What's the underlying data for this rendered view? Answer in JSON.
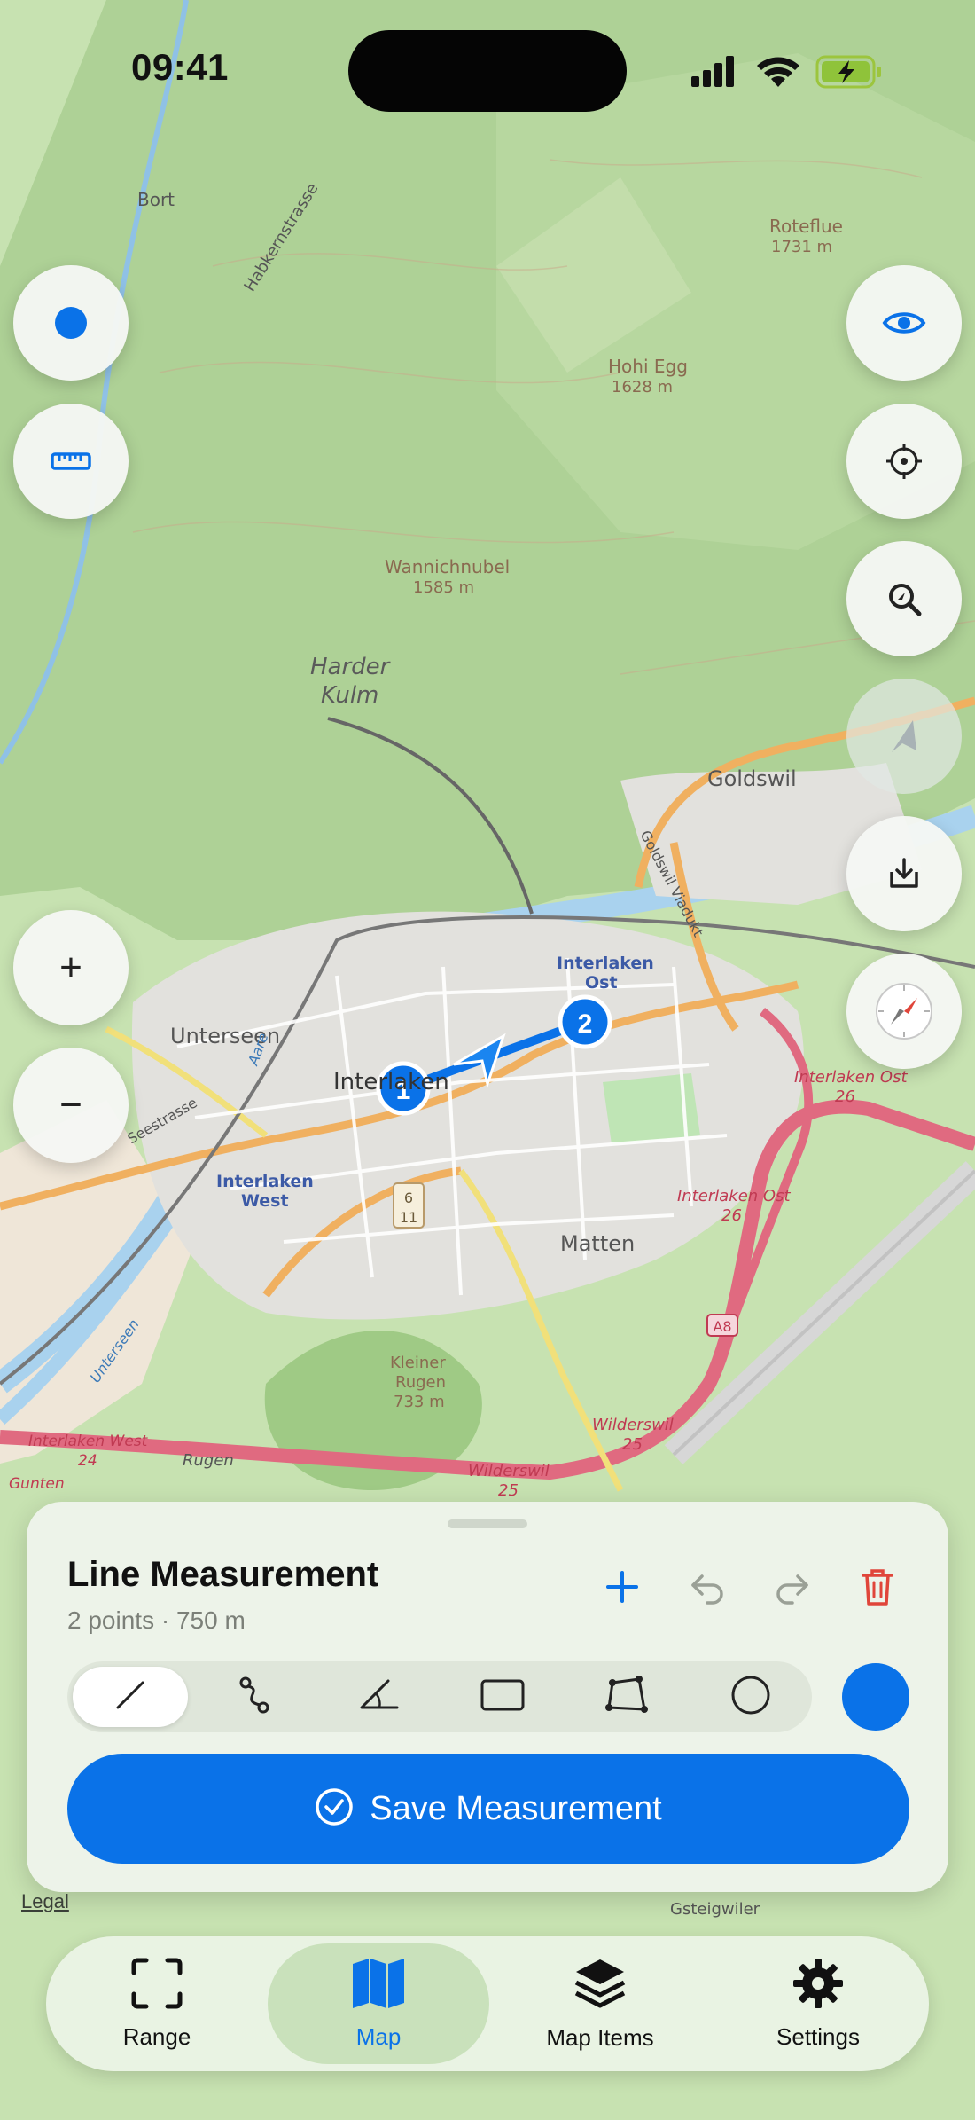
{
  "status_bar": {
    "time": "09:41"
  },
  "map": {
    "labels": [
      {
        "text": "Bort"
      },
      {
        "text": "Habkernstrasse"
      },
      {
        "text": "Roteflue"
      },
      {
        "text": "1731 m"
      },
      {
        "text": "Hohi Egg"
      },
      {
        "text": "1628 m"
      },
      {
        "text": "Wannichnubel"
      },
      {
        "text": "1585 m"
      },
      {
        "text": "Harder"
      },
      {
        "text": "Kulm"
      },
      {
        "text": "Goldswil"
      },
      {
        "text": "Interlaken"
      },
      {
        "text": "Ost"
      },
      {
        "text": "Unterseen"
      },
      {
        "text": "Interlaken"
      },
      {
        "text": "Interlaken"
      },
      {
        "text": "West"
      },
      {
        "text": "Seestrasse"
      },
      {
        "text": "Matten"
      },
      {
        "text": "Interlaken Ost"
      },
      {
        "text": "26"
      },
      {
        "text": "Interlaken Ost"
      },
      {
        "text": "26"
      },
      {
        "text": "Kleiner"
      },
      {
        "text": "Rugen"
      },
      {
        "text": "733 m"
      },
      {
        "text": "Interlaken West"
      },
      {
        "text": "24"
      },
      {
        "text": "Rugen"
      },
      {
        "text": "Wilderswil"
      },
      {
        "text": "25"
      },
      {
        "text": "Wilderswil"
      },
      {
        "text": "25"
      },
      {
        "text": "Gunten"
      },
      {
        "text": "Gsteigwiler"
      },
      {
        "text": "Goldswil Viadukt"
      },
      {
        "text": "A8"
      },
      {
        "text": "6"
      },
      {
        "text": "11"
      },
      {
        "text": "Aare"
      },
      {
        "text": "Unterseen"
      }
    ],
    "points": [
      "1",
      "2"
    ]
  },
  "controls": {
    "left": [
      "location-dot-icon",
      "ruler-icon"
    ],
    "zoom": {
      "in": "+",
      "out": "−"
    },
    "right": [
      "eye-icon",
      "crosshair-icon",
      "zoom-search-icon",
      "navigation-arrow-icon",
      "download-tray-icon",
      "compass-icon"
    ]
  },
  "sheet": {
    "title": "Line Measurement",
    "subtitle": "2 points · 750 m",
    "actions": [
      "add-point-icon",
      "undo-icon",
      "redo-icon",
      "trash-icon"
    ],
    "tools": [
      "line-tool",
      "path-tool",
      "angle-tool",
      "rectangle-tool",
      "polygon-tool",
      "circle-tool"
    ],
    "active_tool": "line-tool",
    "color": "#0a72e8",
    "save_label": "Save Measurement"
  },
  "legal": "Legal",
  "tabs": [
    {
      "label": "Range",
      "icon": "viewfinder-icon"
    },
    {
      "label": "Map",
      "icon": "map-icon",
      "active": true
    },
    {
      "label": "Map Items",
      "icon": "layers-icon"
    },
    {
      "label": "Settings",
      "icon": "gear-icon"
    }
  ],
  "colors": {
    "accent": "#0a72e8",
    "delete": "#e0453a",
    "road_red": "#e06a80",
    "road_orange": "#f0b060",
    "forest": "#a9cf8f",
    "urban": "#e3e1dc"
  }
}
